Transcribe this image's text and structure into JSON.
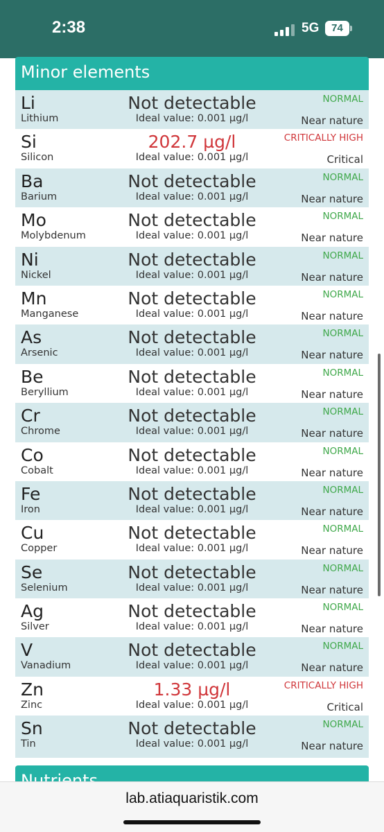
{
  "status_bar": {
    "time": "2:38",
    "network": "5G",
    "battery": "74"
  },
  "section": {
    "title": "Minor elements"
  },
  "next_section": {
    "title": "Nutrients"
  },
  "rows": [
    {
      "symbol": "Li",
      "name": "Lithium",
      "value": "Not detectable",
      "ideal": "Ideal value: 0.001 µg/l",
      "status": "NORMAL",
      "note": "Near nature",
      "level": "normal"
    },
    {
      "symbol": "Si",
      "name": "Silicon",
      "value": "202.7 µg/l",
      "ideal": "Ideal value: 0.001 µg/l",
      "status": "CRITICALLY HIGH",
      "note": "Critical",
      "level": "critical"
    },
    {
      "symbol": "Ba",
      "name": "Barium",
      "value": "Not detectable",
      "ideal": "Ideal value: 0.001 µg/l",
      "status": "NORMAL",
      "note": "Near nature",
      "level": "normal"
    },
    {
      "symbol": "Mo",
      "name": "Molybdenum",
      "value": "Not detectable",
      "ideal": "Ideal value: 0.001 µg/l",
      "status": "NORMAL",
      "note": "Near nature",
      "level": "normal"
    },
    {
      "symbol": "Ni",
      "name": "Nickel",
      "value": "Not detectable",
      "ideal": "Ideal value: 0.001 µg/l",
      "status": "NORMAL",
      "note": "Near nature",
      "level": "normal"
    },
    {
      "symbol": "Mn",
      "name": "Manganese",
      "value": "Not detectable",
      "ideal": "Ideal value: 0.001 µg/l",
      "status": "NORMAL",
      "note": "Near nature",
      "level": "normal"
    },
    {
      "symbol": "As",
      "name": "Arsenic",
      "value": "Not detectable",
      "ideal": "Ideal value: 0.001 µg/l",
      "status": "NORMAL",
      "note": "Near nature",
      "level": "normal"
    },
    {
      "symbol": "Be",
      "name": "Beryllium",
      "value": "Not detectable",
      "ideal": "Ideal value: 0.001 µg/l",
      "status": "NORMAL",
      "note": "Near nature",
      "level": "normal"
    },
    {
      "symbol": "Cr",
      "name": "Chrome",
      "value": "Not detectable",
      "ideal": "Ideal value: 0.001 µg/l",
      "status": "NORMAL",
      "note": "Near nature",
      "level": "normal"
    },
    {
      "symbol": "Co",
      "name": "Cobalt",
      "value": "Not detectable",
      "ideal": "Ideal value: 0.001 µg/l",
      "status": "NORMAL",
      "note": "Near nature",
      "level": "normal"
    },
    {
      "symbol": "Fe",
      "name": "Iron",
      "value": "Not detectable",
      "ideal": "Ideal value: 0.001 µg/l",
      "status": "NORMAL",
      "note": "Near nature",
      "level": "normal"
    },
    {
      "symbol": "Cu",
      "name": "Copper",
      "value": "Not detectable",
      "ideal": "Ideal value: 0.001 µg/l",
      "status": "NORMAL",
      "note": "Near nature",
      "level": "normal"
    },
    {
      "symbol": "Se",
      "name": "Selenium",
      "value": "Not detectable",
      "ideal": "Ideal value: 0.001 µg/l",
      "status": "NORMAL",
      "note": "Near nature",
      "level": "normal"
    },
    {
      "symbol": "Ag",
      "name": "Silver",
      "value": "Not detectable",
      "ideal": "Ideal value: 0.001 µg/l",
      "status": "NORMAL",
      "note": "Near nature",
      "level": "normal"
    },
    {
      "symbol": "V",
      "name": "Vanadium",
      "value": "Not detectable",
      "ideal": "Ideal value: 0.001 µg/l",
      "status": "NORMAL",
      "note": "Near nature",
      "level": "normal"
    },
    {
      "symbol": "Zn",
      "name": "Zinc",
      "value": "1.33 µg/l",
      "ideal": "Ideal value: 0.001 µg/l",
      "status": "CRITICALLY HIGH",
      "note": "Critical",
      "level": "critical"
    },
    {
      "symbol": "Sn",
      "name": "Tin",
      "value": "Not detectable",
      "ideal": "Ideal value: 0.001 µg/l",
      "status": "NORMAL",
      "note": "Near nature",
      "level": "normal"
    }
  ],
  "browser": {
    "url": "lab.atiaquaristik.com"
  },
  "colors": {
    "status_bar": "#2c6e66",
    "header": "#24b3a6",
    "row_shaded": "#d6e9ec",
    "normal": "#3fa84a",
    "critical": "#d0363a"
  }
}
